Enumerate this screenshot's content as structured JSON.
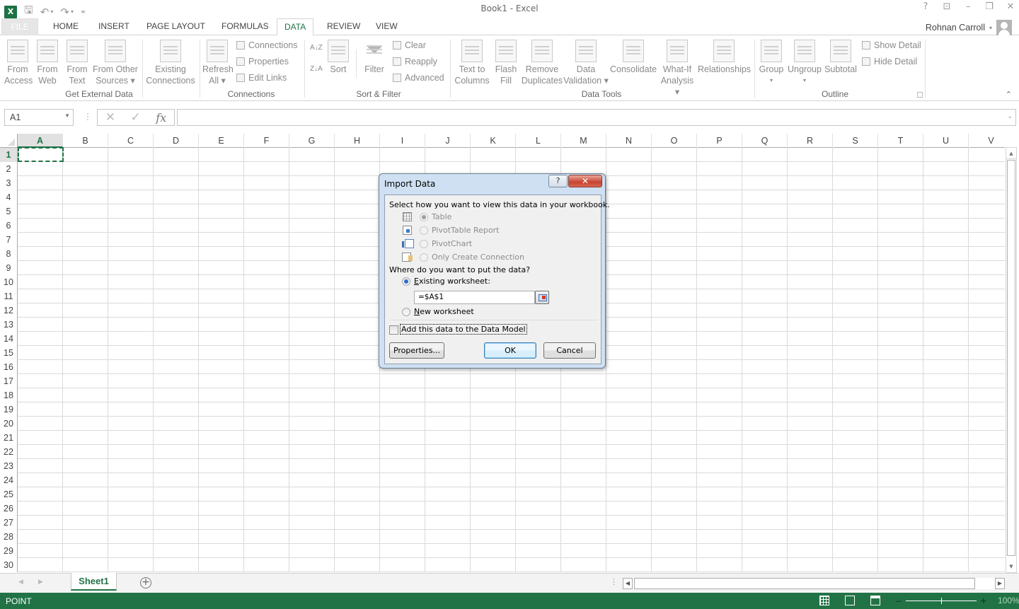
{
  "window": {
    "title": "Book1 - Excel",
    "controls": [
      "help-icon",
      "ribbon-display-icon",
      "minimize-icon",
      "restore-icon",
      "close-icon"
    ],
    "quick_access": [
      "excel-logo-icon",
      "save-icon",
      "undo-icon",
      "redo-icon",
      "customize-qat-icon"
    ]
  },
  "user": {
    "name": "Rohnan Carroll"
  },
  "tabs": [
    {
      "label": "FILE",
      "active": false
    },
    {
      "label": "HOME",
      "active": false
    },
    {
      "label": "INSERT",
      "active": false
    },
    {
      "label": "PAGE LAYOUT",
      "active": false
    },
    {
      "label": "FORMULAS",
      "active": false
    },
    {
      "label": "DATA",
      "active": true
    },
    {
      "label": "REVIEW",
      "active": false
    },
    {
      "label": "VIEW",
      "active": false
    }
  ],
  "ribbon": {
    "groups": [
      {
        "label": "Get External Data"
      },
      {
        "label": "Connections"
      },
      {
        "label": "Sort & Filter"
      },
      {
        "label": "Data Tools"
      },
      {
        "label": "Outline"
      }
    ],
    "get_external": {
      "from_access": [
        "From",
        "Access"
      ],
      "from_web": [
        "From",
        "Web"
      ],
      "from_text": [
        "From",
        "Text"
      ],
      "from_other": [
        "From Other",
        "Sources ▾"
      ],
      "existing": [
        "Existing",
        "Connections"
      ]
    },
    "connections": {
      "refresh": [
        "Refresh",
        "All ▾"
      ],
      "connections": "Connections",
      "properties": "Properties",
      "edit_links": "Edit Links"
    },
    "sort_filter": {
      "sort_az": "A↓Z",
      "sort_za": "Z↓A",
      "sort": "Sort",
      "filter": "Filter",
      "clear": "Clear",
      "reapply": "Reapply",
      "advanced": "Advanced"
    },
    "data_tools": {
      "text_to_columns": [
        "Text to",
        "Columns"
      ],
      "flash_fill": [
        "Flash",
        "Fill"
      ],
      "remove_duplicates": [
        "Remove",
        "Duplicates"
      ],
      "data_validation": [
        "Data",
        "Validation ▾"
      ],
      "consolidate": "Consolidate",
      "what_if": [
        "What-If",
        "Analysis ▾"
      ],
      "relationships": "Relationships"
    },
    "outline": {
      "group": [
        "Group",
        "▾"
      ],
      "ungroup": [
        "Ungroup",
        "▾"
      ],
      "subtotal": "Subtotal",
      "show_detail": "Show Detail",
      "hide_detail": "Hide Detail"
    }
  },
  "formula_bar": {
    "name_box": "A1",
    "cancel": "✕",
    "enter": "✓",
    "fx": "fx",
    "value": ""
  },
  "grid": {
    "columns": [
      "A",
      "B",
      "C",
      "D",
      "E",
      "F",
      "G",
      "H",
      "I",
      "J",
      "K",
      "L",
      "M",
      "N",
      "O",
      "P",
      "Q",
      "R",
      "S",
      "T",
      "U",
      "V"
    ],
    "rows": [
      1,
      2,
      3,
      4,
      5,
      6,
      7,
      8,
      9,
      10,
      11,
      12,
      13,
      14,
      15,
      16,
      17,
      18,
      19,
      20,
      21,
      22,
      23,
      24,
      25,
      26,
      27,
      28,
      29,
      30
    ],
    "active_cell": "A1"
  },
  "sheets": {
    "tabs": [
      "Sheet1"
    ],
    "active": "Sheet1"
  },
  "status": {
    "mode": "POINT",
    "zoom": "100%",
    "zoom_fraction": 1.0
  },
  "dialog": {
    "title": "Import Data",
    "help": "?",
    "close": "✕",
    "view_prompt": "Select how you want to view this data in your workbook.",
    "view_options": [
      {
        "label": "Table",
        "selected": true,
        "enabled": false,
        "icon": "table-icon"
      },
      {
        "label": "PivotTable Report",
        "selected": false,
        "enabled": false,
        "icon": "pivottable-icon"
      },
      {
        "label": "PivotChart",
        "selected": false,
        "enabled": false,
        "icon": "pivotchart-icon"
      },
      {
        "label": "Only Create Connection",
        "selected": false,
        "enabled": false,
        "icon": "connection-icon"
      }
    ],
    "location_prompt": "Where do you want to put the data?",
    "existing_worksheet": {
      "label": "Existing worksheet:",
      "selected": true
    },
    "range_value": "=$A$1",
    "new_worksheet": {
      "label": "New worksheet",
      "selected": false
    },
    "data_model": {
      "label": "Add this data to the Data Model",
      "checked": false
    },
    "properties_button": "Properties...",
    "ok_button": "OK",
    "cancel_button": "Cancel"
  }
}
